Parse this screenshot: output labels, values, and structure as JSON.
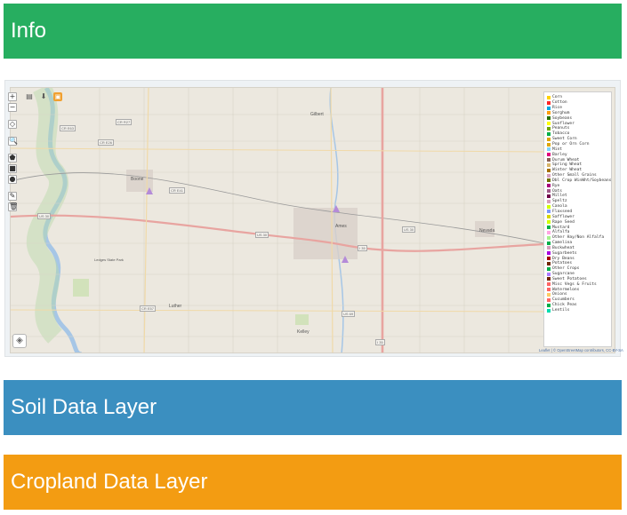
{
  "panels": {
    "info_title": "Info",
    "soil_title": "Soil Data Layer",
    "cropland_title": "Cropland Data Layer"
  },
  "map": {
    "toolbar": {
      "zoom_in": "+",
      "zoom_out": "−",
      "locate": "◇",
      "search": "🔍",
      "draw_polygon": "⬟",
      "draw_rectangle": "■",
      "draw_marker": "●",
      "edit": "✎",
      "delete": "🗑"
    },
    "top_tools": [
      "▤",
      "⬇",
      "▣"
    ],
    "layers_button": "◈",
    "places": {
      "boone": "Boone",
      "ames": "Ames",
      "nevada": "Nevada",
      "gilbert": "Gilbert",
      "luther": "Luther",
      "kelley": "Kelley",
      "ledges": "Ledges State Park"
    },
    "routes": [
      "US 30",
      "US 30",
      "US 30",
      "I 35",
      "I 35",
      "US 69",
      "CR R27",
      "CR E26",
      "CR E41",
      "CR E57",
      "CR E63"
    ],
    "attribution": "Leaflet | © OpenStreetMap contributors, CC-BY-SA"
  },
  "legend": {
    "items": [
      {
        "label": "Corn",
        "color": "#ffd300"
      },
      {
        "label": "Cotton",
        "color": "#ff2626"
      },
      {
        "label": "Rice",
        "color": "#00a8e2"
      },
      {
        "label": "Sorghum",
        "color": "#ff9e0a"
      },
      {
        "label": "Soybeans",
        "color": "#267000"
      },
      {
        "label": "Sunflower",
        "color": "#ffff00"
      },
      {
        "label": "Peanuts",
        "color": "#70a500"
      },
      {
        "label": "Tobacco",
        "color": "#00af49"
      },
      {
        "label": "Sweet Corn",
        "color": "#dda50a"
      },
      {
        "label": "Pop or Orn Corn",
        "color": "#dda50a"
      },
      {
        "label": "Mint",
        "color": "#7cd3ff"
      },
      {
        "label": "Barley",
        "color": "#e2007c"
      },
      {
        "label": "Durum Wheat",
        "color": "#896054"
      },
      {
        "label": "Spring Wheat",
        "color": "#d8b56b"
      },
      {
        "label": "Winter Wheat",
        "color": "#a57000"
      },
      {
        "label": "Other Small Grains",
        "color": "#d69ebc"
      },
      {
        "label": "Dbl Crop WinWht/Soybeans",
        "color": "#707000"
      },
      {
        "label": "Rye",
        "color": "#aa007c"
      },
      {
        "label": "Oats",
        "color": "#a05989"
      },
      {
        "label": "Millet",
        "color": "#700049"
      },
      {
        "label": "Speltz",
        "color": "#d69ebc"
      },
      {
        "label": "Canola",
        "color": "#d1ff00"
      },
      {
        "label": "Flaxseed",
        "color": "#7c99ff"
      },
      {
        "label": "Safflower",
        "color": "#d6d600"
      },
      {
        "label": "Rape Seed",
        "color": "#d1ff00"
      },
      {
        "label": "Mustard",
        "color": "#00af49"
      },
      {
        "label": "Alfalfa",
        "color": "#ffa5e2"
      },
      {
        "label": "Other Hay/Non Alfalfa",
        "color": "#a5f28c"
      },
      {
        "label": "Camelina",
        "color": "#00af49"
      },
      {
        "label": "Buckwheat",
        "color": "#d69ebc"
      },
      {
        "label": "Sugarbeets",
        "color": "#a800e2"
      },
      {
        "label": "Dry Beans",
        "color": "#a50000"
      },
      {
        "label": "Potatoes",
        "color": "#702600"
      },
      {
        "label": "Other Crops",
        "color": "#00af49"
      },
      {
        "label": "Sugarcane",
        "color": "#af7cff"
      },
      {
        "label": "Sweet Potatoes",
        "color": "#702600"
      },
      {
        "label": "Misc Vegs & Fruits",
        "color": "#ff6666"
      },
      {
        "label": "Watermelons",
        "color": "#ff6666"
      },
      {
        "label": "Onions",
        "color": "#ffcc66"
      },
      {
        "label": "Cucumbers",
        "color": "#ff6666"
      },
      {
        "label": "Chick Peas",
        "color": "#00af49"
      },
      {
        "label": "Lentils",
        "color": "#00ddaf"
      }
    ]
  }
}
